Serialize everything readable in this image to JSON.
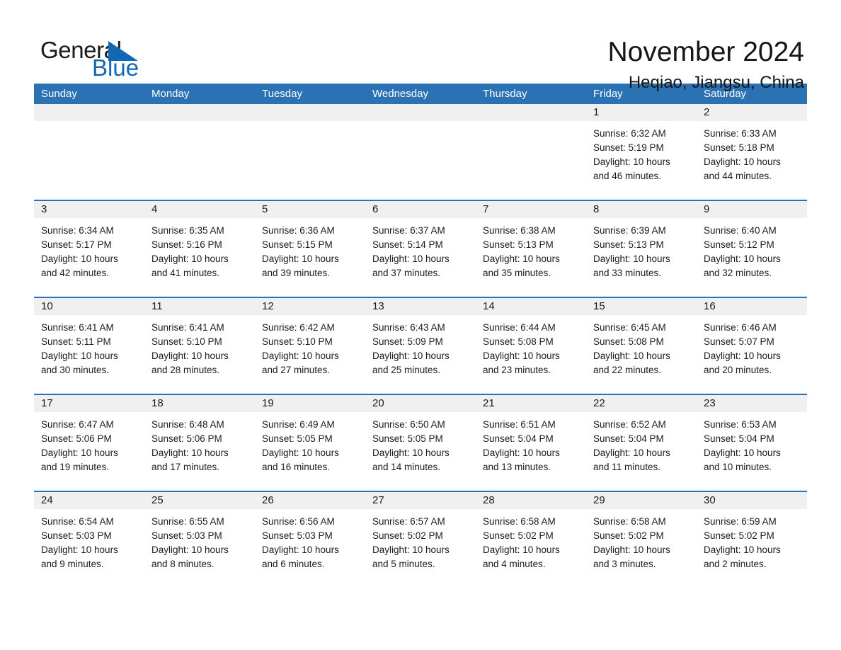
{
  "brand": {
    "name_dark": "General",
    "name_light": "Blue",
    "flag_icon": "triangle-flag-icon",
    "accent_color": "#1268b3"
  },
  "header": {
    "title": "November 2024",
    "subtitle": "Heqiao, Jiangsu, China"
  },
  "theme": {
    "header_blue": "#2b72b5",
    "day_strip_gray": "#f0f0f0",
    "text_color": "#1b1b1b"
  },
  "weekdays": [
    "Sunday",
    "Monday",
    "Tuesday",
    "Wednesday",
    "Thursday",
    "Friday",
    "Saturday"
  ],
  "weeks": [
    [
      {
        "day": "",
        "sunrise": "",
        "sunset": "",
        "daylight": "",
        "daylight2": ""
      },
      {
        "day": "",
        "sunrise": "",
        "sunset": "",
        "daylight": "",
        "daylight2": ""
      },
      {
        "day": "",
        "sunrise": "",
        "sunset": "",
        "daylight": "",
        "daylight2": ""
      },
      {
        "day": "",
        "sunrise": "",
        "sunset": "",
        "daylight": "",
        "daylight2": ""
      },
      {
        "day": "",
        "sunrise": "",
        "sunset": "",
        "daylight": "",
        "daylight2": ""
      },
      {
        "day": "1",
        "sunrise": "Sunrise: 6:32 AM",
        "sunset": "Sunset: 5:19 PM",
        "daylight": "Daylight: 10 hours",
        "daylight2": "and 46 minutes."
      },
      {
        "day": "2",
        "sunrise": "Sunrise: 6:33 AM",
        "sunset": "Sunset: 5:18 PM",
        "daylight": "Daylight: 10 hours",
        "daylight2": "and 44 minutes."
      }
    ],
    [
      {
        "day": "3",
        "sunrise": "Sunrise: 6:34 AM",
        "sunset": "Sunset: 5:17 PM",
        "daylight": "Daylight: 10 hours",
        "daylight2": "and 42 minutes."
      },
      {
        "day": "4",
        "sunrise": "Sunrise: 6:35 AM",
        "sunset": "Sunset: 5:16 PM",
        "daylight": "Daylight: 10 hours",
        "daylight2": "and 41 minutes."
      },
      {
        "day": "5",
        "sunrise": "Sunrise: 6:36 AM",
        "sunset": "Sunset: 5:15 PM",
        "daylight": "Daylight: 10 hours",
        "daylight2": "and 39 minutes."
      },
      {
        "day": "6",
        "sunrise": "Sunrise: 6:37 AM",
        "sunset": "Sunset: 5:14 PM",
        "daylight": "Daylight: 10 hours",
        "daylight2": "and 37 minutes."
      },
      {
        "day": "7",
        "sunrise": "Sunrise: 6:38 AM",
        "sunset": "Sunset: 5:13 PM",
        "daylight": "Daylight: 10 hours",
        "daylight2": "and 35 minutes."
      },
      {
        "day": "8",
        "sunrise": "Sunrise: 6:39 AM",
        "sunset": "Sunset: 5:13 PM",
        "daylight": "Daylight: 10 hours",
        "daylight2": "and 33 minutes."
      },
      {
        "day": "9",
        "sunrise": "Sunrise: 6:40 AM",
        "sunset": "Sunset: 5:12 PM",
        "daylight": "Daylight: 10 hours",
        "daylight2": "and 32 minutes."
      }
    ],
    [
      {
        "day": "10",
        "sunrise": "Sunrise: 6:41 AM",
        "sunset": "Sunset: 5:11 PM",
        "daylight": "Daylight: 10 hours",
        "daylight2": "and 30 minutes."
      },
      {
        "day": "11",
        "sunrise": "Sunrise: 6:41 AM",
        "sunset": "Sunset: 5:10 PM",
        "daylight": "Daylight: 10 hours",
        "daylight2": "and 28 minutes."
      },
      {
        "day": "12",
        "sunrise": "Sunrise: 6:42 AM",
        "sunset": "Sunset: 5:10 PM",
        "daylight": "Daylight: 10 hours",
        "daylight2": "and 27 minutes."
      },
      {
        "day": "13",
        "sunrise": "Sunrise: 6:43 AM",
        "sunset": "Sunset: 5:09 PM",
        "daylight": "Daylight: 10 hours",
        "daylight2": "and 25 minutes."
      },
      {
        "day": "14",
        "sunrise": "Sunrise: 6:44 AM",
        "sunset": "Sunset: 5:08 PM",
        "daylight": "Daylight: 10 hours",
        "daylight2": "and 23 minutes."
      },
      {
        "day": "15",
        "sunrise": "Sunrise: 6:45 AM",
        "sunset": "Sunset: 5:08 PM",
        "daylight": "Daylight: 10 hours",
        "daylight2": "and 22 minutes."
      },
      {
        "day": "16",
        "sunrise": "Sunrise: 6:46 AM",
        "sunset": "Sunset: 5:07 PM",
        "daylight": "Daylight: 10 hours",
        "daylight2": "and 20 minutes."
      }
    ],
    [
      {
        "day": "17",
        "sunrise": "Sunrise: 6:47 AM",
        "sunset": "Sunset: 5:06 PM",
        "daylight": "Daylight: 10 hours",
        "daylight2": "and 19 minutes."
      },
      {
        "day": "18",
        "sunrise": "Sunrise: 6:48 AM",
        "sunset": "Sunset: 5:06 PM",
        "daylight": "Daylight: 10 hours",
        "daylight2": "and 17 minutes."
      },
      {
        "day": "19",
        "sunrise": "Sunrise: 6:49 AM",
        "sunset": "Sunset: 5:05 PM",
        "daylight": "Daylight: 10 hours",
        "daylight2": "and 16 minutes."
      },
      {
        "day": "20",
        "sunrise": "Sunrise: 6:50 AM",
        "sunset": "Sunset: 5:05 PM",
        "daylight": "Daylight: 10 hours",
        "daylight2": "and 14 minutes."
      },
      {
        "day": "21",
        "sunrise": "Sunrise: 6:51 AM",
        "sunset": "Sunset: 5:04 PM",
        "daylight": "Daylight: 10 hours",
        "daylight2": "and 13 minutes."
      },
      {
        "day": "22",
        "sunrise": "Sunrise: 6:52 AM",
        "sunset": "Sunset: 5:04 PM",
        "daylight": "Daylight: 10 hours",
        "daylight2": "and 11 minutes."
      },
      {
        "day": "23",
        "sunrise": "Sunrise: 6:53 AM",
        "sunset": "Sunset: 5:04 PM",
        "daylight": "Daylight: 10 hours",
        "daylight2": "and 10 minutes."
      }
    ],
    [
      {
        "day": "24",
        "sunrise": "Sunrise: 6:54 AM",
        "sunset": "Sunset: 5:03 PM",
        "daylight": "Daylight: 10 hours",
        "daylight2": "and 9 minutes."
      },
      {
        "day": "25",
        "sunrise": "Sunrise: 6:55 AM",
        "sunset": "Sunset: 5:03 PM",
        "daylight": "Daylight: 10 hours",
        "daylight2": "and 8 minutes."
      },
      {
        "day": "26",
        "sunrise": "Sunrise: 6:56 AM",
        "sunset": "Sunset: 5:03 PM",
        "daylight": "Daylight: 10 hours",
        "daylight2": "and 6 minutes."
      },
      {
        "day": "27",
        "sunrise": "Sunrise: 6:57 AM",
        "sunset": "Sunset: 5:02 PM",
        "daylight": "Daylight: 10 hours",
        "daylight2": "and 5 minutes."
      },
      {
        "day": "28",
        "sunrise": "Sunrise: 6:58 AM",
        "sunset": "Sunset: 5:02 PM",
        "daylight": "Daylight: 10 hours",
        "daylight2": "and 4 minutes."
      },
      {
        "day": "29",
        "sunrise": "Sunrise: 6:58 AM",
        "sunset": "Sunset: 5:02 PM",
        "daylight": "Daylight: 10 hours",
        "daylight2": "and 3 minutes."
      },
      {
        "day": "30",
        "sunrise": "Sunrise: 6:59 AM",
        "sunset": "Sunset: 5:02 PM",
        "daylight": "Daylight: 10 hours",
        "daylight2": "and 2 minutes."
      }
    ]
  ]
}
